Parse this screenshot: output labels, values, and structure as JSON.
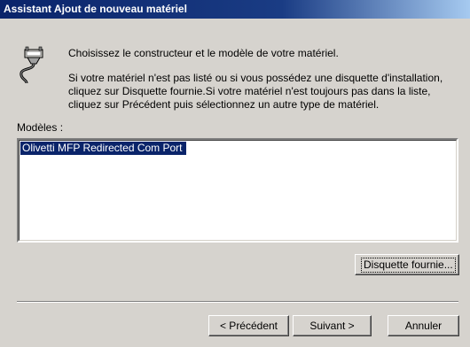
{
  "window": {
    "title": "Assistant Ajout de nouveau matériel"
  },
  "intro": {
    "line1": "Choisissez le constructeur et le modèle de votre matériel.",
    "line2": "Si votre matériel n'est pas listé ou si vous possédez une disquette d'installation, cliquez sur Disquette fournie.Si votre matériel n'est toujours pas dans la liste, cliquez sur Précédent puis sélectionnez un autre type de matériel."
  },
  "models": {
    "label": "Modèles :",
    "items": [
      "Olivetti MFP Redirected Com Port"
    ]
  },
  "buttons": {
    "have_disk": "Disquette fournie...",
    "back": "< Précédent",
    "next": "Suivant >",
    "cancel": "Annuler"
  },
  "icon": "serial-port-cable-icon"
}
